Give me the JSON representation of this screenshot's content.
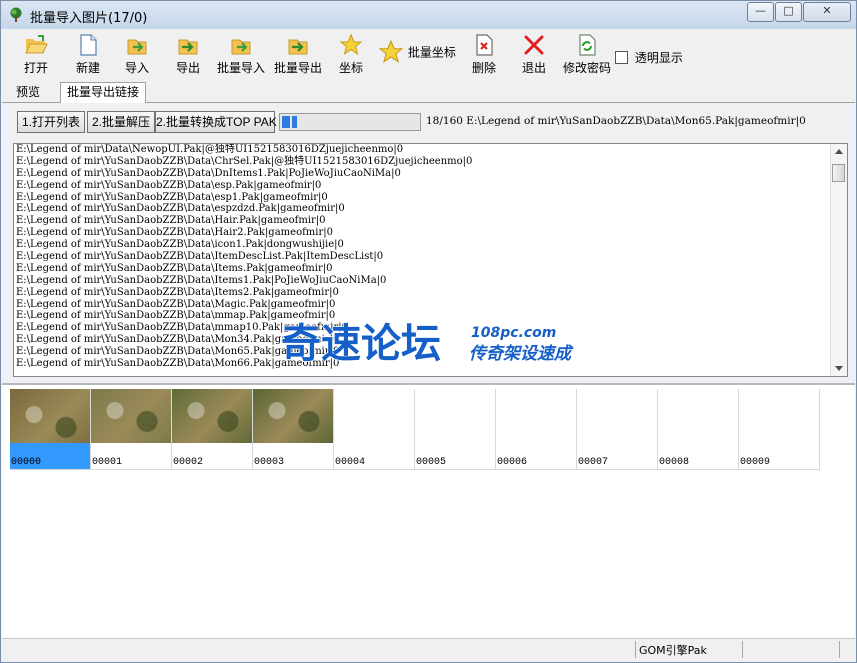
{
  "window": {
    "title": "批量导入图片(17/0)",
    "minimize_label": "—",
    "maximize_label": "□",
    "close_label": "✕"
  },
  "toolbar": {
    "buttons": [
      {
        "label": "打开",
        "icon": "folder-open-icon"
      },
      {
        "label": "新建",
        "icon": "new-file-icon"
      },
      {
        "label": "导入",
        "icon": "import-icon"
      },
      {
        "label": "导出",
        "icon": "export-icon"
      },
      {
        "label": "批量导入",
        "icon": "batch-import-icon"
      },
      {
        "label": "批量导出",
        "icon": "batch-export-icon"
      },
      {
        "label": "坐标",
        "icon": "star-icon"
      }
    ],
    "batch_coord_label": "批量坐标",
    "delete_label": "删除",
    "exit_label": "退出",
    "change_password_label": "修改密码",
    "transparent_label": "透明显示"
  },
  "tabs": [
    {
      "label": "预览",
      "active": false
    },
    {
      "label": "批量导出链接",
      "active": true
    }
  ],
  "actions": {
    "open_list": "1.打开列表",
    "batch_unpack": "2.批量解压",
    "batch_convert": "2.批量转换成TOP PAK"
  },
  "progress": {
    "value": 0.1125,
    "status": "18/160 E:\\Legend of mir\\YuSanDaobZZB\\Data\\Mon65.Pak|gameofmir|0"
  },
  "log_lines": [
    "E:\\Legend of mir\\Data\\NewopUI.Pak|@独特UI1521583016DZjuejicheenmo|0",
    "E:\\Legend of mir\\YuSanDaobZZB\\Data\\ChrSel.Pak|@独特UI1521583016DZjuejicheenmo|0",
    "E:\\Legend of mir\\YuSanDaobZZB\\Data\\DnItems1.Pak|PoJieWoJiuCaoNiMa|0",
    "E:\\Legend of mir\\YuSanDaobZZB\\Data\\esp.Pak|gameofmir|0",
    "E:\\Legend of mir\\YuSanDaobZZB\\Data\\esp1.Pak|gameofmir|0",
    "E:\\Legend of mir\\YuSanDaobZZB\\Data\\espzdzd.Pak|gameofmir|0",
    "E:\\Legend of mir\\YuSanDaobZZB\\Data\\Hair.Pak|gameofmir|0",
    "E:\\Legend of mir\\YuSanDaobZZB\\Data\\Hair2.Pak|gameofmir|0",
    "E:\\Legend of mir\\YuSanDaobZZB\\Data\\icon1.Pak|dongwushijie|0",
    "E:\\Legend of mir\\YuSanDaobZZB\\Data\\ItemDescList.Pak|ItemDescList|0",
    "E:\\Legend of mir\\YuSanDaobZZB\\Data\\Items.Pak|gameofmir|0",
    "E:\\Legend of mir\\YuSanDaobZZB\\Data\\Items1.Pak|PoJieWoJiuCaoNiMa|0",
    "E:\\Legend of mir\\YuSanDaobZZB\\Data\\Items2.Pak|gameofmir|0",
    "E:\\Legend of mir\\YuSanDaobZZB\\Data\\Magic.Pak|gameofmir|0",
    "E:\\Legend of mir\\YuSanDaobZZB\\Data\\mmap.Pak|gameofmir|0",
    "E:\\Legend of mir\\YuSanDaobZZB\\Data\\mmap10.Pak|gameofmir|0",
    "E:\\Legend of mir\\YuSanDaobZZB\\Data\\Mon34.Pak|gameofmir|0",
    "E:\\Legend of mir\\YuSanDaobZZB\\Data\\Mon65.Pak|gameofmir|0",
    "E:\\Legend of mir\\YuSanDaobZZB\\Data\\Mon66.Pak|gameofmir|0"
  ],
  "watermark": {
    "brand": "奇速论坛",
    "site": "108pc.com",
    "slogan": "传奇架设速成"
  },
  "thumbnails": [
    {
      "name": "00000",
      "selected": true,
      "has_image": true,
      "tone": "#7a6a3c"
    },
    {
      "name": "00001",
      "selected": false,
      "has_image": true,
      "tone": "#7d7a4a"
    },
    {
      "name": "00002",
      "selected": false,
      "has_image": true,
      "tone": "#5f6a36"
    },
    {
      "name": "00003",
      "selected": false,
      "has_image": true,
      "tone": "#5b6634"
    },
    {
      "name": "00004",
      "selected": false,
      "has_image": false
    },
    {
      "name": "00005",
      "selected": false,
      "has_image": false
    },
    {
      "name": "00006",
      "selected": false,
      "has_image": false
    },
    {
      "name": "00007",
      "selected": false,
      "has_image": false
    },
    {
      "name": "00008",
      "selected": false,
      "has_image": false
    },
    {
      "name": "00009",
      "selected": false,
      "has_image": false
    }
  ],
  "statusbar": {
    "engine": "GOM引擎Pak"
  },
  "colors": {
    "accent": "#3399ff",
    "progress": "#2d7ce0",
    "watermark_blue": "#1560c8"
  }
}
